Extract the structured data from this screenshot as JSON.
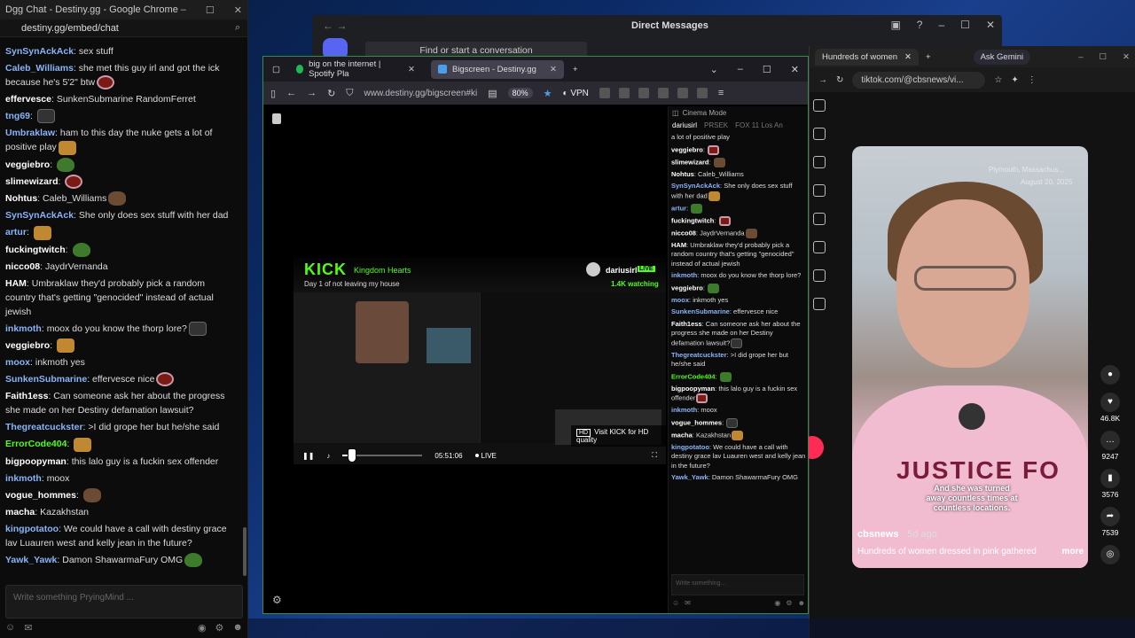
{
  "left_window": {
    "title": "Dgg Chat - Destiny.gg - Google Chrome",
    "url": "destiny.gg/embed/chat",
    "messages": [
      {
        "user": "SynSynAckAck",
        "color": "#8ab4f8",
        "text": "sex stuff"
      },
      {
        "user": "Caleb_Williams",
        "color": "#8ab4f8",
        "text": "she met this guy irl and got the ick because he's 5'2\" btw"
      },
      {
        "user": "effervesce",
        "color": "#ffffff",
        "text": "SunkenSubmarine RandomFerret"
      },
      {
        "user": "tng69",
        "color": "#8ab4f8",
        "text": ""
      },
      {
        "user": "Umbraklaw",
        "color": "#8ab4f8",
        "text": "ham to this day the nuke gets a lot of positive play"
      },
      {
        "user": "veggiebro",
        "color": "#ffffff",
        "text": ""
      },
      {
        "user": "slimewizard",
        "color": "#ffffff",
        "text": ""
      },
      {
        "user": "Nohtus",
        "color": "#ffffff",
        "text": "Caleb_Williams"
      },
      {
        "user": "SynSynAckAck",
        "color": "#8ab4f8",
        "text": "She only does sex stuff with her dad"
      },
      {
        "user": "artur",
        "color": "#8ab4f8",
        "text": ""
      },
      {
        "user": "fuckingtwitch",
        "color": "#ffffff",
        "text": ""
      },
      {
        "user": "nicco08",
        "color": "#ffffff",
        "text": "JaydrVernanda"
      },
      {
        "user": "HAM",
        "color": "#ffffff",
        "text": "Umbraklaw they'd probably pick a random country that's getting \"genocided\" instead of actual jewish"
      },
      {
        "user": "inkmoth",
        "color": "#8ab4f8",
        "text": "moox do you know the thorp lore?"
      },
      {
        "user": "veggiebro",
        "color": "#ffffff",
        "text": ""
      },
      {
        "user": "moox",
        "color": "#8ab4f8",
        "text": "inkmoth yes"
      },
      {
        "user": "SunkenSubmarine",
        "color": "#8ab4f8",
        "text": "effervesce nice"
      },
      {
        "user": "Faith1ess",
        "color": "#ffffff",
        "text": "Can someone ask her about the progress she made on her Destiny defamation lawsuit?"
      },
      {
        "user": "Thegreatcuckster",
        "color": "#8ab4f8",
        "text": ">I did grope her but he/she said"
      },
      {
        "user": "ErrorCode404",
        "color": "#53fc18",
        "text": ""
      },
      {
        "user": "bigpoopyman",
        "color": "#ffffff",
        "text": "this lalo guy is a fuckin sex offender"
      },
      {
        "user": "inkmoth",
        "color": "#8ab4f8",
        "text": "moox"
      },
      {
        "user": "vogue_hommes",
        "color": "#ffffff",
        "text": ""
      },
      {
        "user": "macha",
        "color": "#ffffff",
        "text": "Kazakhstan"
      },
      {
        "user": "kingpotatoo",
        "color": "#8ab4f8",
        "text": "We could have a call with destiny grace lav Luauren west and kelly jean in the future?"
      },
      {
        "user": "Yawk_Yawk",
        "color": "#8ab4f8",
        "text": "Damon ShawarmaFury OMG"
      }
    ],
    "input_placeholder": "Write something PryingMind ..."
  },
  "dm_window": {
    "title": "Direct Messages",
    "find_placeholder": "Find or start a conversation"
  },
  "firefox": {
    "tabs": [
      {
        "label": "big on the internet | Spotify Pla"
      },
      {
        "label": "Bigscreen - Destiny.gg"
      }
    ],
    "url": "www.destiny.gg/bigscreen#ki",
    "zoom": "80%",
    "vpn": "VPN",
    "stream": {
      "logo": "KICK",
      "category": "Kingdom Hearts",
      "title": "Day 1 of not leaving my house",
      "streamer": "dariusirl",
      "live_badge": "LIVE",
      "watching": "1.4K watching",
      "hd_notice": "Visit KICK for HD quality",
      "hd_badge": "HD",
      "elapsed": "05:51:06",
      "live_label": "LIVE",
      "progress": 0.08
    },
    "chat_panel": {
      "header": "Cinema Mode",
      "tabs": [
        "dariusirl",
        "PRSEK",
        "FOX 11 Los An"
      ],
      "messages": [
        {
          "user": "",
          "color": "#ffffff",
          "text": "a lot of positive play"
        },
        {
          "user": "veggiebro",
          "color": "#ffffff",
          "text": ""
        },
        {
          "user": "slimewizard",
          "color": "#ffffff",
          "text": ""
        },
        {
          "user": "Nohtus",
          "color": "#ffffff",
          "text": "Caleb_Williams"
        },
        {
          "user": "SynSynAckAck",
          "color": "#8ab4f8",
          "text": "She only does sex stuff with her dad"
        },
        {
          "user": "artur",
          "color": "#8ab4f8",
          "text": ""
        },
        {
          "user": "fuckingtwitch",
          "color": "#ffffff",
          "text": ""
        },
        {
          "user": "nicco08",
          "color": "#ffffff",
          "text": "JaydrVernanda"
        },
        {
          "user": "HAM",
          "color": "#ffffff",
          "text": "Umbraklaw they'd probably pick a random country that's getting \"genocided\" instead of actual jewish"
        },
        {
          "user": "inkmoth",
          "color": "#8ab4f8",
          "text": "moox do you know the thorp lore?"
        },
        {
          "user": "veggiebro",
          "color": "#ffffff",
          "text": ""
        },
        {
          "user": "moox",
          "color": "#8ab4f8",
          "text": "inkmoth yes"
        },
        {
          "user": "SunkenSubmarine",
          "color": "#8ab4f8",
          "text": "effervesce nice"
        },
        {
          "user": "Faith1ess",
          "color": "#ffffff",
          "text": "Can someone ask her about the progress she made on her Destiny defamation lawsuit?"
        },
        {
          "user": "Thegreatcuckster",
          "color": "#8ab4f8",
          "text": ">I did grope her but he/she said"
        },
        {
          "user": "ErrorCode404",
          "color": "#53fc18",
          "text": ""
        },
        {
          "user": "bigpoopyman",
          "color": "#ffffff",
          "text": "this lalo guy is a fuckin sex offender"
        },
        {
          "user": "inkmoth",
          "color": "#8ab4f8",
          "text": "moox"
        },
        {
          "user": "vogue_hommes",
          "color": "#ffffff",
          "text": ""
        },
        {
          "user": "macha",
          "color": "#ffffff",
          "text": "Kazakhstan"
        },
        {
          "user": "kingpotatoo",
          "color": "#8ab4f8",
          "text": "We could have a call with destiny grace lav Luauren west and kelly jean in the future?"
        },
        {
          "user": "Yawk_Yawk",
          "color": "#8ab4f8",
          "text": "Damon ShawarmaFury OMG"
        }
      ],
      "input_placeholder": "Write something..."
    }
  },
  "tiktok": {
    "tab_label": "Hundreds of women",
    "gemini": "Ask Gemini",
    "url": "tiktok.com/@cbsnews/vi...",
    "location": "Plymouth, Massachus...",
    "date": "August 20, 2025",
    "shirt_text": "JUSTICE FO",
    "caption": "And she was turned away countless times at countless locations.",
    "author": "cbsnews",
    "ago": "· 5d ago",
    "description": "Hundreds of women dressed in pink gathered",
    "more": "more",
    "likes": "46.8K",
    "comments": "9247",
    "saves": "3576",
    "shares": "7539"
  },
  "colors": {
    "kick_green": "#53fc18",
    "user_blue": "#8ab4f8",
    "tiktok_red": "#fe2c55"
  }
}
